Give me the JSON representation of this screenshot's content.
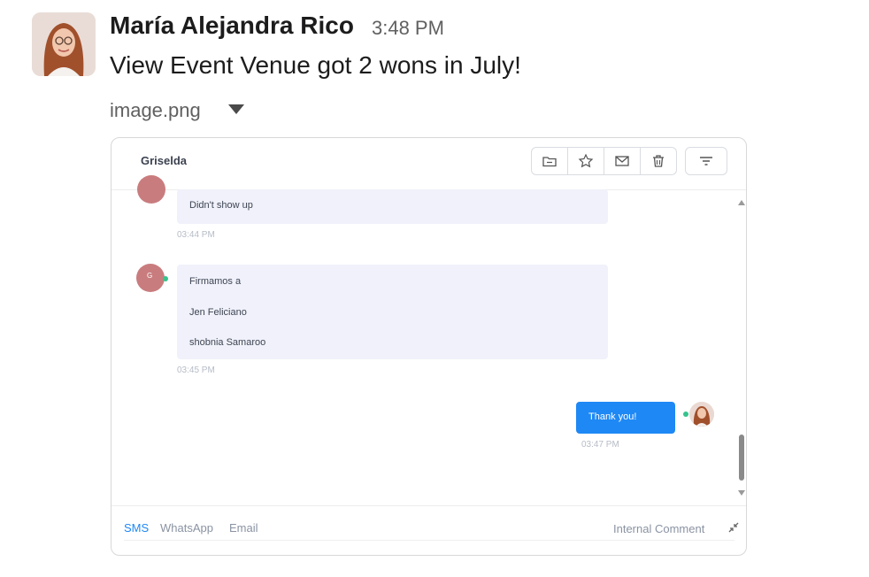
{
  "message": {
    "sender": "María Alejandra Rico",
    "time": "3:48 PM",
    "text": "View Event Venue got 2 wons in July!",
    "attachment": {
      "file_name": "image.png"
    }
  },
  "screenshot": {
    "contact_name": "Griselda",
    "toolbar": {
      "icons": [
        "folder-icon",
        "star-icon",
        "mail-icon",
        "trash-icon",
        "filter-icon"
      ]
    },
    "conversation": [
      {
        "direction": "inbound",
        "lines": [
          "Didn't show up"
        ],
        "time": "03:44 PM"
      },
      {
        "direction": "inbound",
        "avatar_initial": "G",
        "lines": [
          "Firmamos a",
          "Jen Feliciano",
          "shobnia Samaroo"
        ],
        "time": "03:45 PM"
      },
      {
        "direction": "outbound",
        "lines": [
          "Thank you!"
        ],
        "time": "03:47 PM"
      }
    ],
    "composer": {
      "tabs": [
        "SMS",
        "WhatsApp",
        "Email"
      ],
      "active_tab": "SMS",
      "internal_comment": "Internal Comment"
    }
  },
  "colors": {
    "accent": "#1e88f5",
    "online": "#35c38c",
    "avatar_bg": "#c97c7e"
  }
}
